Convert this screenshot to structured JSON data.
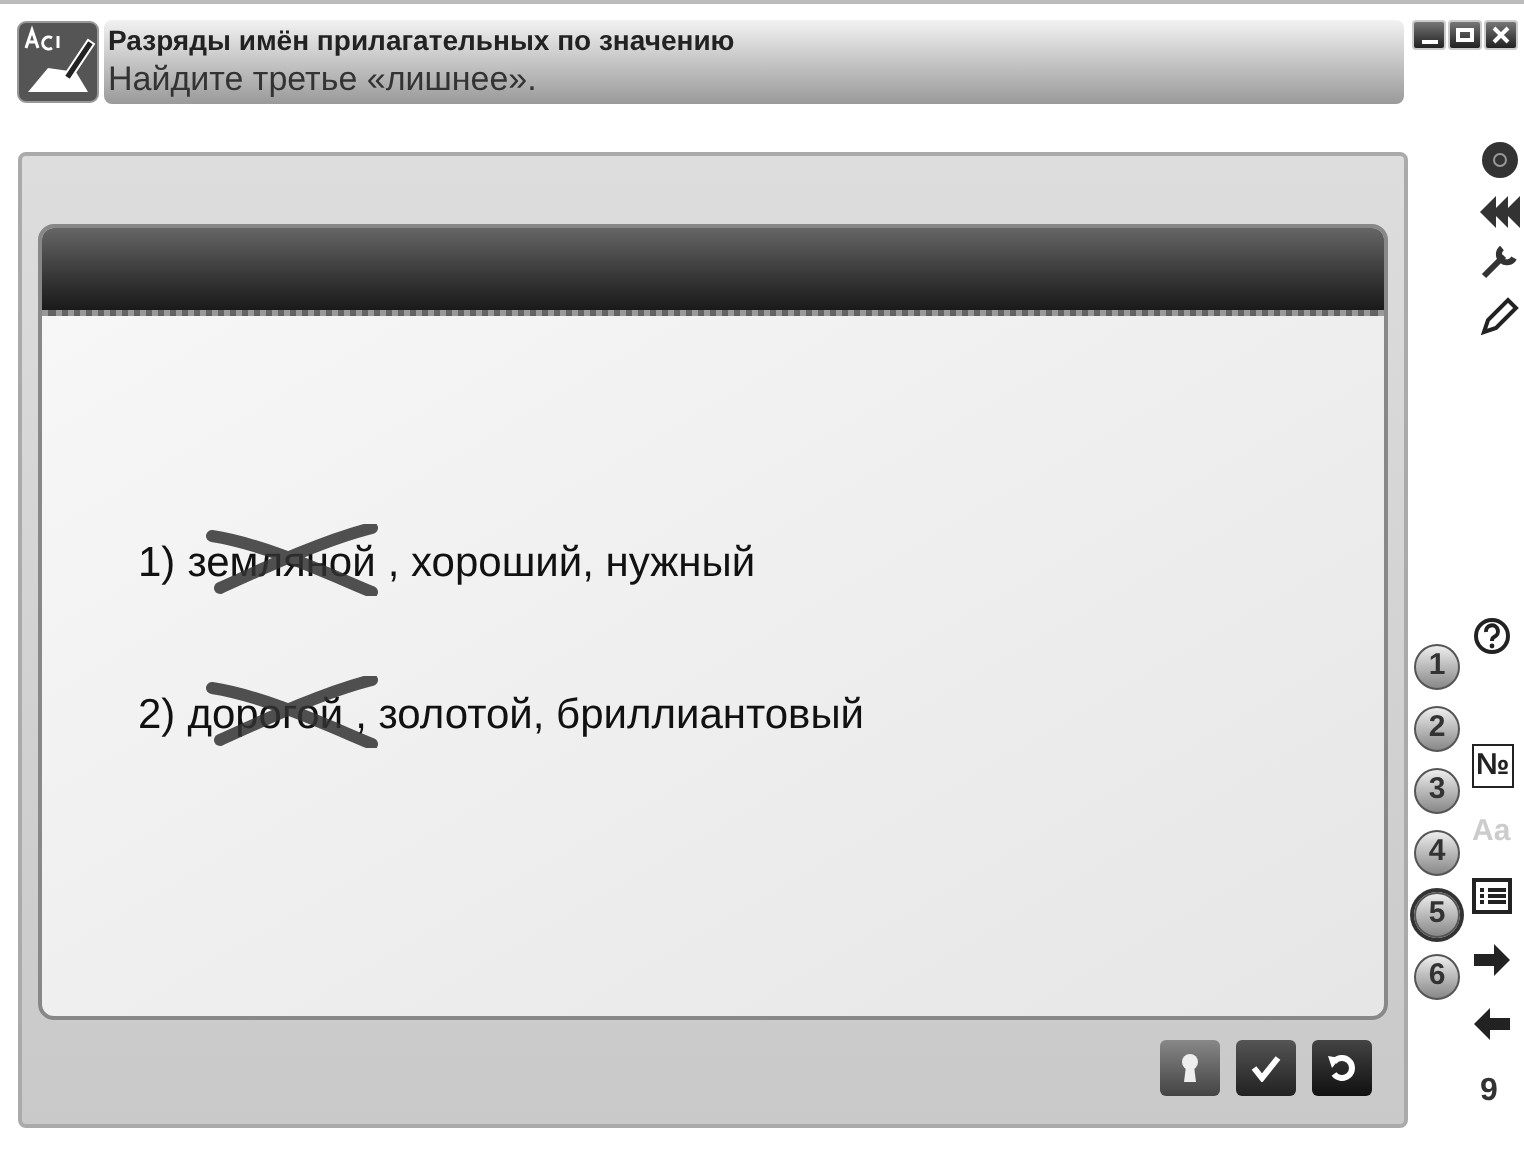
{
  "header": {
    "title": "Разряды имён прилагательных по значению",
    "instruction": "Найдите третье «лишнее»."
  },
  "items": [
    {
      "number": "1)",
      "words": [
        {
          "text": "земляной",
          "crossed": true
        },
        {
          "text": ", хороший, нужный",
          "crossed": false
        }
      ]
    },
    {
      "number": "2)",
      "words": [
        {
          "text": "дорогой",
          "crossed": true
        },
        {
          "text": ", золотой, бриллиантовый",
          "crossed": false
        }
      ]
    }
  ],
  "tasks": [
    {
      "label": "1",
      "selected": false
    },
    {
      "label": "2",
      "selected": false
    },
    {
      "label": "3",
      "selected": false
    },
    {
      "label": "4",
      "selected": false
    },
    {
      "label": "5",
      "selected": true
    },
    {
      "label": "6",
      "selected": false
    }
  ],
  "side_tools": [
    {
      "kind": "help"
    },
    {
      "kind": "blank"
    },
    {
      "kind": "text",
      "text": "№",
      "disabled": false
    },
    {
      "kind": "text",
      "text": "Aa",
      "disabled": true
    },
    {
      "kind": "list"
    },
    {
      "kind": "next"
    },
    {
      "kind": "prev"
    }
  ],
  "page_number": "9"
}
